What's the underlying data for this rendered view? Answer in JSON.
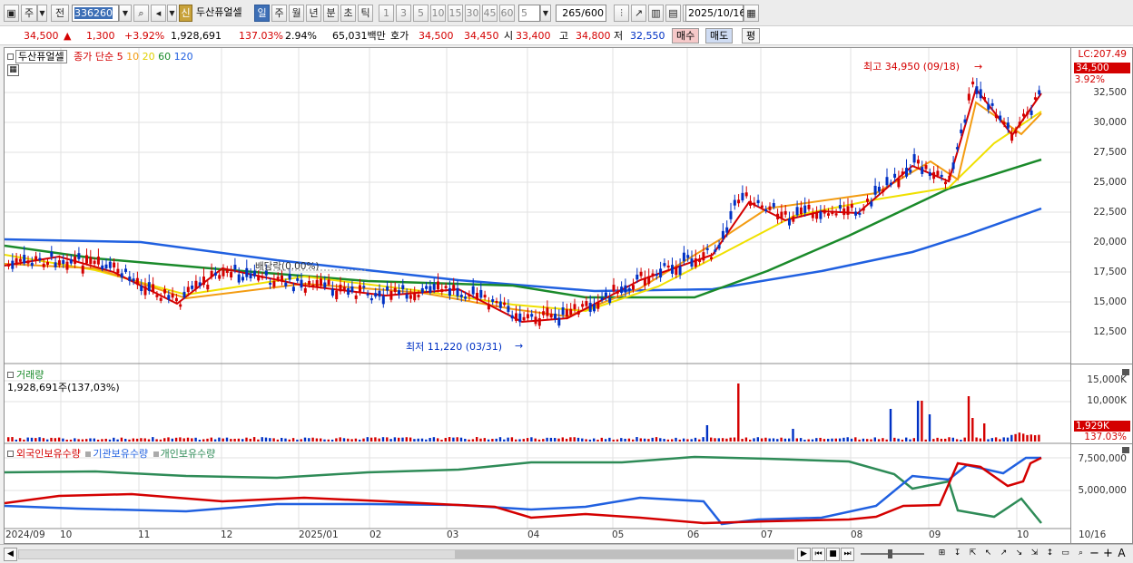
{
  "toolbar": {
    "market": "주",
    "prev": "전",
    "code": "336260",
    "stock_name": "두산퓨얼셀",
    "credit_badge": "신",
    "periods": [
      "일",
      "주",
      "월",
      "년",
      "분",
      "초",
      "틱"
    ],
    "intervals": [
      "1",
      "3",
      "5",
      "10",
      "15",
      "30",
      "45",
      "60"
    ],
    "custom_interval": "5",
    "count": "265",
    "count_max": "600",
    "date": "2025/10/16"
  },
  "quote": {
    "price": "34,500",
    "arrow": "▲",
    "change": "1,300",
    "change_pct": "+3.92%",
    "volume": "1,928,691",
    "volume_ratio": "137.03%",
    "turnover": "2.94%",
    "amount": "65,031백만",
    "ask_label": "호가",
    "ask1": "34,500",
    "ask2": "34,450",
    "open_label": "시",
    "open": "33,400",
    "high_label": "고",
    "high": "34,800",
    "low_label": "저",
    "low": "32,550",
    "buy": "매수",
    "sell": "매도",
    "eval": "평"
  },
  "legend": {
    "stock": "두산퓨얼셀",
    "ma_label": "종가 단순",
    "ma": [
      "5",
      "10",
      "20",
      "60",
      "120"
    ],
    "ma_colors": [
      "#d40000",
      "#f39c12",
      "#f0e000",
      "#1a8a2a",
      "#2060e0"
    ],
    "volume": "거래량",
    "volume_value": "1,928,691주(137,03%)",
    "holders": [
      "외국인보유수량",
      "기관보유수량",
      "개인보유수량"
    ],
    "holder_colors": [
      "#d40000",
      "#2060e0",
      "#2e8b57"
    ]
  },
  "annotations": {
    "high": "최고 34,950 (09/18)",
    "low": "최저 11,220 (03/31)",
    "dividend": "배당락(0.00%)"
  },
  "price_axis": {
    "lc": "LC:207.49",
    "current": "34,500",
    "current_pct": "3.92%",
    "ticks": [
      "32,500",
      "30,000",
      "27,500",
      "25,000",
      "22,500",
      "20,000",
      "17,500",
      "15,000",
      "12,500"
    ]
  },
  "volume_axis": {
    "ticks": [
      "15,000K",
      "10,000K"
    ],
    "current": "1,929K",
    "current_pct": "137.03%"
  },
  "holder_axis": {
    "ticks": [
      "7,500,000",
      "5,000,000"
    ]
  },
  "x_axis": {
    "labels": [
      "2024/09",
      "10",
      "11",
      "12",
      "2025/01",
      "02",
      "03",
      "04",
      "05",
      "06",
      "07",
      "08",
      "09",
      "10"
    ],
    "end": "10/16"
  },
  "colors": {
    "up": "#d40000",
    "down": "#0031c4",
    "grid": "#e2e2e2"
  }
}
